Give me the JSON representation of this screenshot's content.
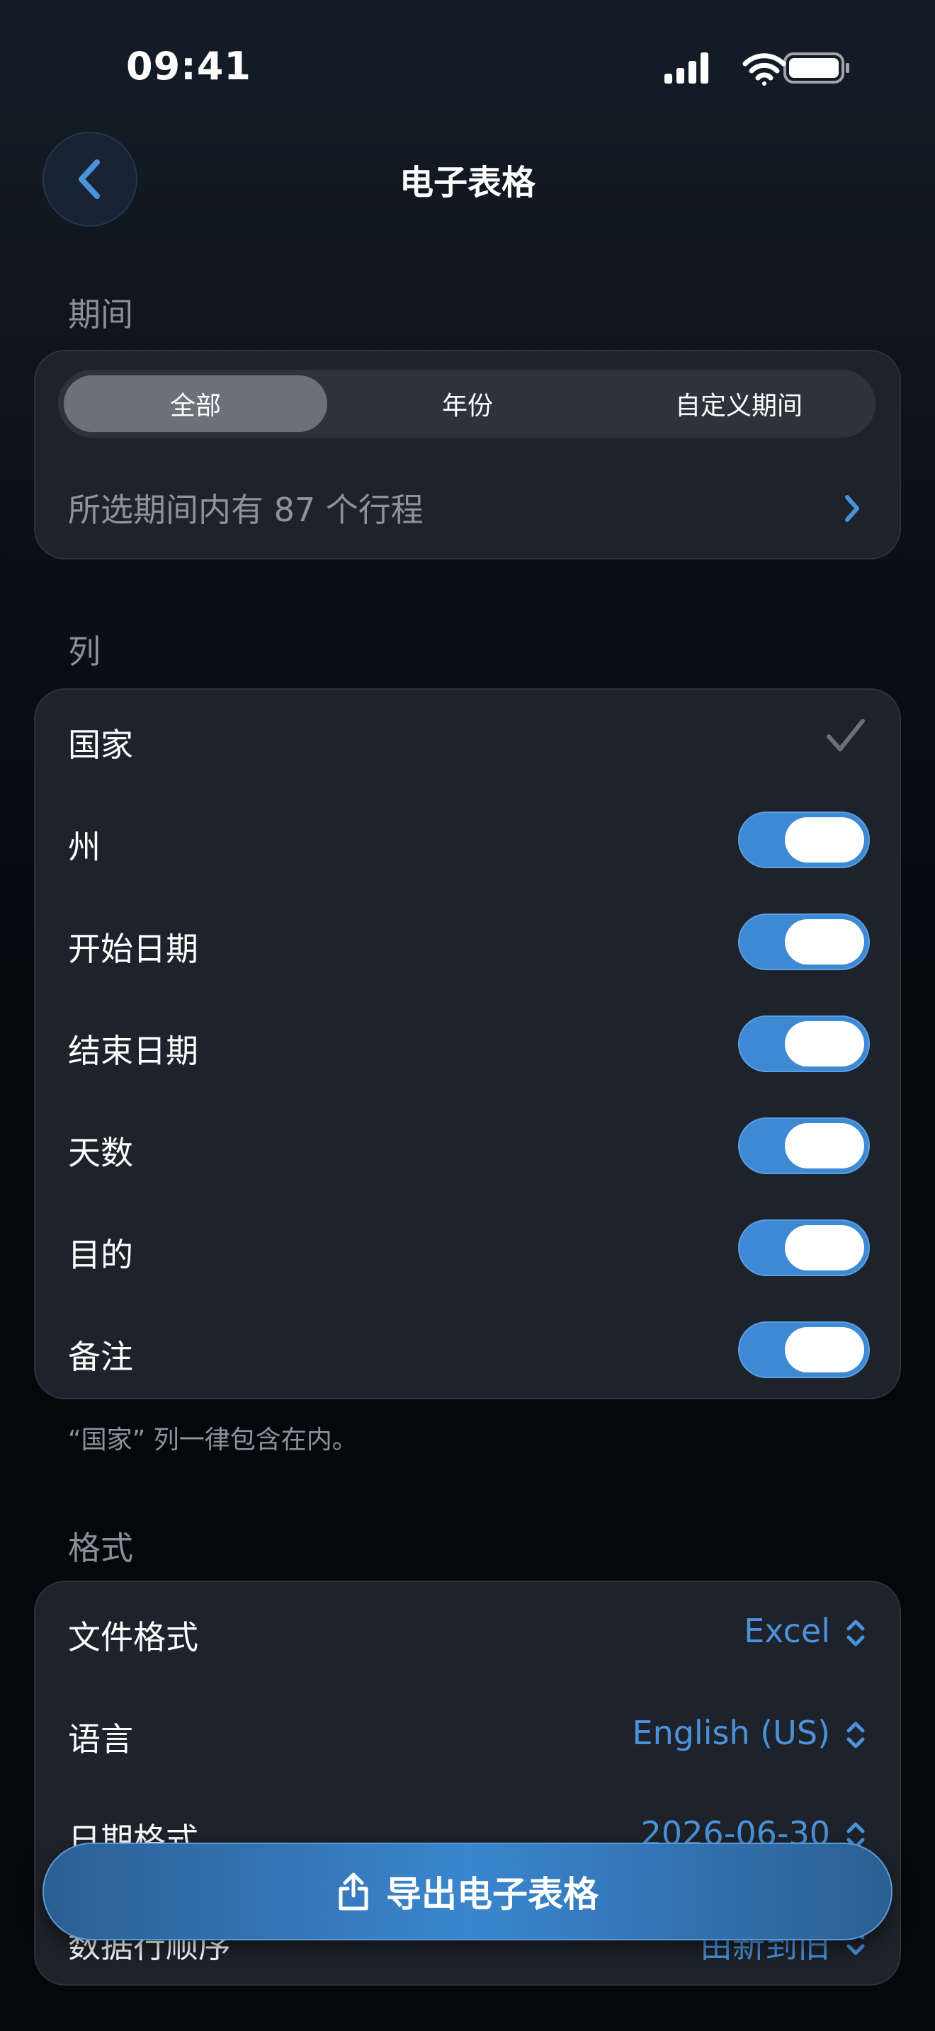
{
  "status_bar": {
    "time": "09:41"
  },
  "nav": {
    "title": "电子表格"
  },
  "period": {
    "section_label": "期间",
    "segments": [
      "全部",
      "年份",
      "自定义期间"
    ],
    "selected_segment": "全部",
    "trips_summary": "所选期间内有 87 个行程"
  },
  "columns": {
    "section_label": "列",
    "items": [
      {
        "label": "国家",
        "state": "checked-locked"
      },
      {
        "label": "州",
        "state": "on"
      },
      {
        "label": "开始日期",
        "state": "on"
      },
      {
        "label": "结束日期",
        "state": "on"
      },
      {
        "label": "天数",
        "state": "on"
      },
      {
        "label": "目的",
        "state": "on"
      },
      {
        "label": "备注",
        "state": "on"
      }
    ],
    "footnote": "“国家” 列一律包含在内。"
  },
  "format": {
    "section_label": "格式",
    "rows": [
      {
        "label": "文件格式",
        "value": "Excel"
      },
      {
        "label": "语言",
        "value": "English (US)"
      },
      {
        "label": "日期格式",
        "value": "2026-06-30"
      },
      {
        "label": "数据行顺序",
        "value": "由新到旧"
      }
    ]
  },
  "export_button": {
    "label": "导出电子表格"
  },
  "colors": {
    "accent": "#3e89d4",
    "card": "#1e232b",
    "secondary_text": "#8d939b"
  },
  "icons": [
    "signal-icon",
    "wifi-icon",
    "battery-icon",
    "back-chevron-icon",
    "chevron-right-icon",
    "checkmark-icon",
    "updown-chevron-icon",
    "share-icon"
  ]
}
